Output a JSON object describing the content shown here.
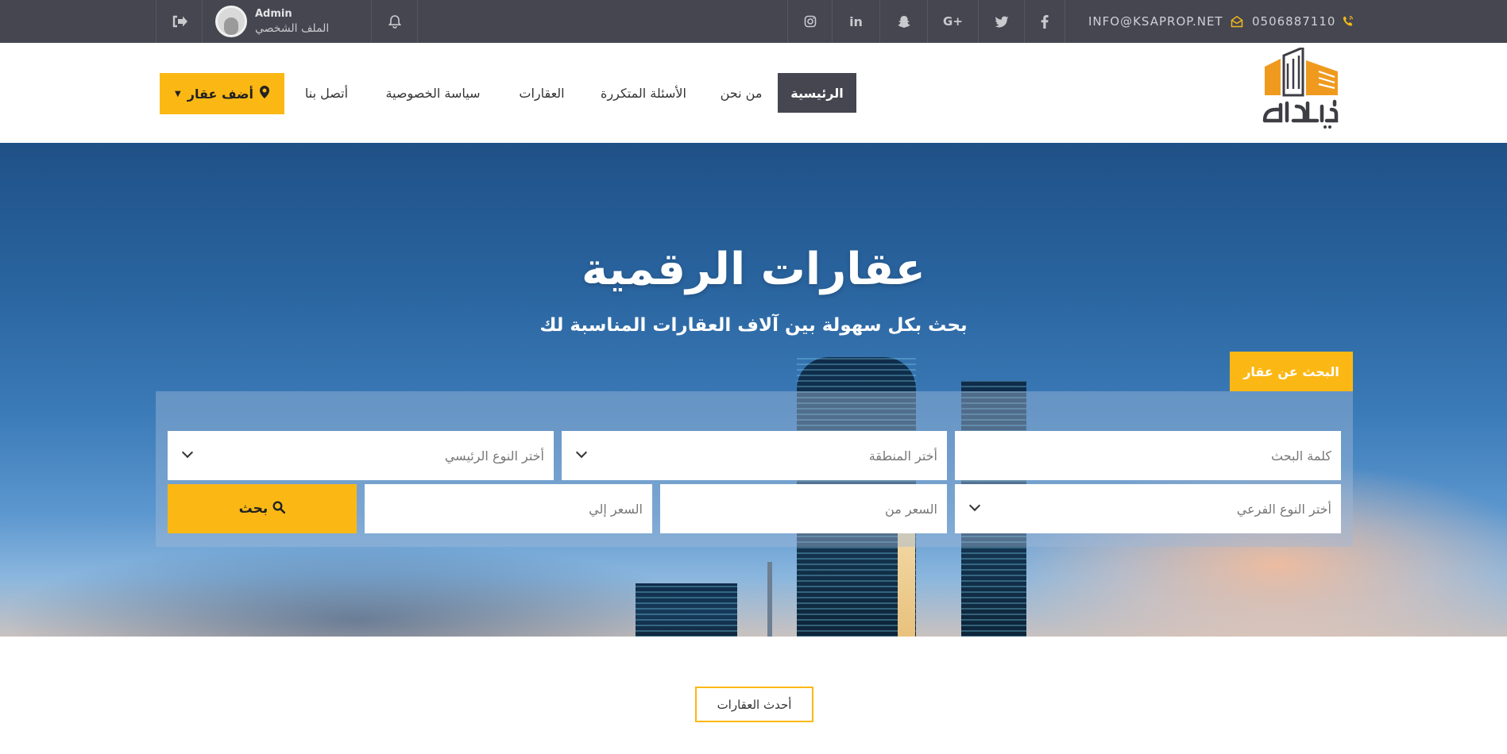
{
  "topbar": {
    "phone": "0506887110",
    "email": "INFO@KSAPROP.NET",
    "social": [
      "facebook-icon",
      "twitter-icon",
      "google-plus-icon",
      "snapchat-icon",
      "linkedin-icon",
      "instagram-icon"
    ],
    "notification_icon": "bell-icon",
    "admin_name": "Admin",
    "profile_label": "الملف الشخصي",
    "logout_icon": "sign-out-icon"
  },
  "header": {
    "logo_text": "عقارات",
    "nav": [
      {
        "label": "الرئيسية",
        "active": true
      },
      {
        "label": "من نحن"
      },
      {
        "label": "الأسئلة المتكررة"
      },
      {
        "label": "العقارات"
      },
      {
        "label": "سياسة الخصوصية"
      },
      {
        "label": "أتصل بنا"
      }
    ],
    "add_property_label": "أضف عقار"
  },
  "hero": {
    "title": "عقارات الرقمية",
    "subtitle": "بحث بكل سهولة بين آلاف العقارات المناسبة لك"
  },
  "search": {
    "tab_label": "البحث عن عقار",
    "keyword_placeholder": "كلمة البحث",
    "region_placeholder": "أختر المنطقة",
    "main_type_placeholder": "أختر النوع الرئيسي",
    "sub_type_placeholder": "أختر النوع الفرعي",
    "price_from_placeholder": "السعر من",
    "price_to_placeholder": "السعر إلي",
    "button_label": "بحث"
  },
  "latest": {
    "label": "أحدث العقارات"
  },
  "colors": {
    "accent": "#fbb814",
    "dark": "#454650"
  }
}
